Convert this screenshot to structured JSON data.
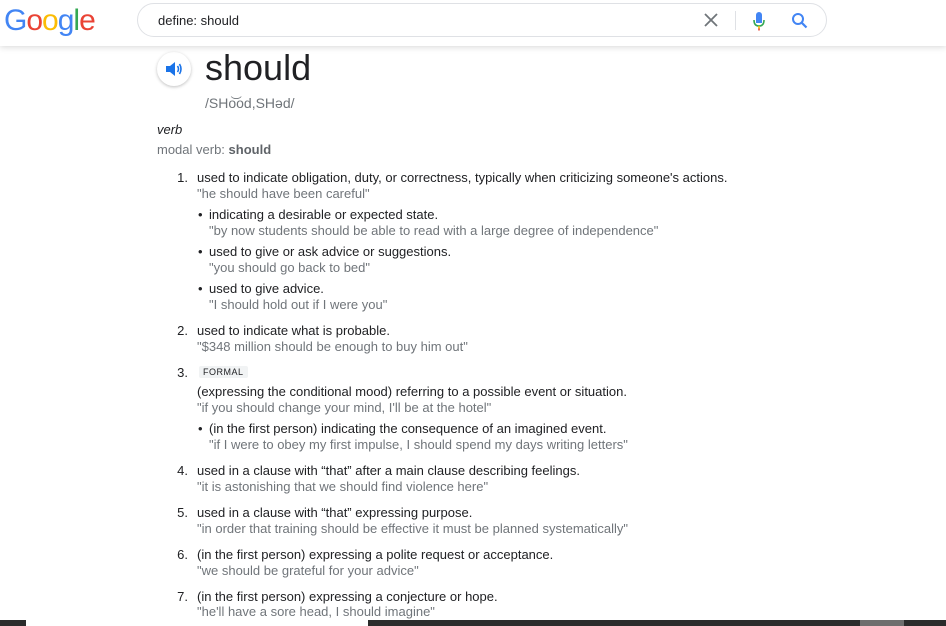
{
  "logo": {
    "letters": [
      {
        "ch": "G",
        "color": "#4285f4"
      },
      {
        "ch": "o",
        "color": "#ea4335"
      },
      {
        "ch": "o",
        "color": "#fbbc05"
      },
      {
        "ch": "g",
        "color": "#4285f4"
      },
      {
        "ch": "l",
        "color": "#34a853"
      },
      {
        "ch": "e",
        "color": "#ea4335"
      }
    ]
  },
  "search": {
    "query": "define: should",
    "icons": [
      "close-icon",
      "mic-icon",
      "search-icon"
    ]
  },
  "entry": {
    "word": "should",
    "phonetic": "/SHo͝od,SHəd/",
    "part_of_speech": "verb",
    "modal_label": "modal verb:",
    "modal_word": "should",
    "speaker_icon": "speaker-icon"
  },
  "definitions": [
    {
      "num": "1.",
      "text": "used to indicate obligation, duty, or correctness, typically when criticizing someone's actions.",
      "example": "\"he should have been careful\"",
      "subs": [
        {
          "text": "indicating a desirable or expected state.",
          "example": "\"by now students should be able to read with a large degree of independence\""
        },
        {
          "text": "used to give or ask advice or suggestions.",
          "example": "\"you should go back to bed\""
        },
        {
          "text": "used to give advice.",
          "example": "\"I should hold out if I were you\""
        }
      ]
    },
    {
      "num": "2.",
      "text": "used to indicate what is probable.",
      "example": "\"$348 million should be enough to buy him out\""
    },
    {
      "num": "3.",
      "label": "FORMAL",
      "text": "(expressing the conditional mood) referring to a possible event or situation.",
      "example": "\"if you should change your mind, I'll be at the hotel\"",
      "subs": [
        {
          "text": "(in the first person) indicating the consequence of an imagined event.",
          "example": "\"if I were to obey my first impulse, I should spend my days writing letters\""
        }
      ]
    },
    {
      "num": "4.",
      "text": "used in a clause with “that” after a main clause describing feelings.",
      "example": "\"it is astonishing that we should find violence here\""
    },
    {
      "num": "5.",
      "text": "used in a clause with “that” expressing purpose.",
      "example": "\"in order that training should be effective it must be planned systematically\""
    },
    {
      "num": "6.",
      "text": "(in the first person) expressing a polite request or acceptance.",
      "example": "\"we should be grateful for your advice\""
    },
    {
      "num": "7.",
      "text": "(in the first person) expressing a conjecture or hope.",
      "example": "\"he'll have a sore head, I should imagine\""
    }
  ]
}
